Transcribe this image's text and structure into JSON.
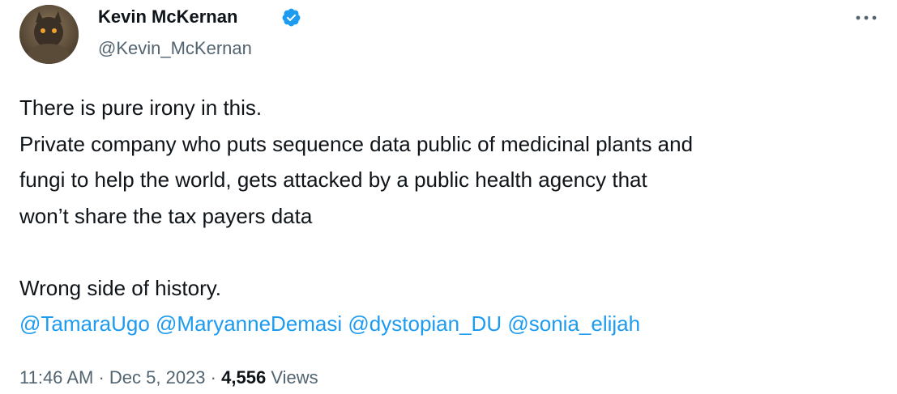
{
  "author": {
    "name": "Kevin McKernan",
    "handle": "@Kevin_McKernan",
    "verified": true,
    "verified_color": "#1d9bf0"
  },
  "tweet": {
    "lines": [
      "There is pure irony in this.",
      "Private company who puts sequence data public of medicinal plants and",
      "fungi to help the world, gets attacked by a public health agency that",
      "won’t share the tax payers data",
      "",
      "Wrong side of history."
    ],
    "mentions": [
      "@TamaraUgo",
      "@MaryanneDemasi",
      "@dystopian_DU",
      "@sonia_elijah"
    ]
  },
  "meta": {
    "time": "11:46 AM",
    "date": "Dec 5, 2023",
    "separator": "·",
    "views_count": "4,556",
    "views_label": "Views"
  },
  "icons": {
    "more": "more-horizontal-icon",
    "verified": "verified-badge-icon"
  },
  "colors": {
    "text": "#0f1419",
    "secondary": "#536471",
    "link": "#1d9bf0"
  }
}
